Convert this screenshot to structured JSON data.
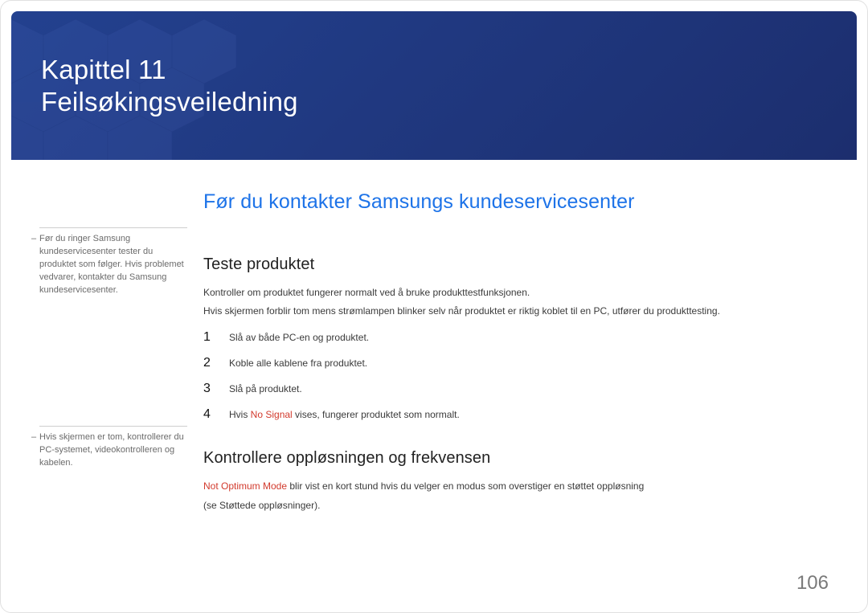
{
  "hero": {
    "chapter_label": "Kapittel 11",
    "chapter_title": "Feilsøkingsveiledning"
  },
  "sidebar": {
    "note1": "Før du ringer Samsung kundeservicesenter tester du produktet som følger. Hvis problemet vedvarer, kontakter du Samsung kundeservicesenter.",
    "note2": "Hvis skjermen er tom, kontrollerer du PC-systemet, videokontrolleren og kabelen."
  },
  "main": {
    "section_heading": "Før du kontakter Samsungs kundeservicesenter",
    "test_heading": "Teste produktet",
    "test_p1": "Kontroller om produktet fungerer normalt ved å bruke produkttestfunksjonen.",
    "test_p2": "Hvis skjermen forblir tom mens strømlampen blinker selv når produktet er riktig koblet til en PC, utfører du produkttesting.",
    "steps": [
      {
        "num": "1",
        "text": "Slå av både PC-en og produktet."
      },
      {
        "num": "2",
        "text": "Koble alle kablene fra produktet."
      },
      {
        "num": "3",
        "text": "Slå på produktet."
      },
      {
        "num": "4",
        "pre": "Hvis ",
        "highlight": "No Signal",
        "post": " vises, fungerer produktet som normalt."
      }
    ],
    "resfreq_heading": "Kontrollere oppløsningen og frekvensen",
    "resfreq_highlight": "Not Optimum Mode",
    "resfreq_p1_post": " blir vist en kort stund hvis du velger en modus som overstiger en støttet oppløsning",
    "resfreq_p2": "(se Støttede oppløsninger)."
  },
  "page_number": "106"
}
